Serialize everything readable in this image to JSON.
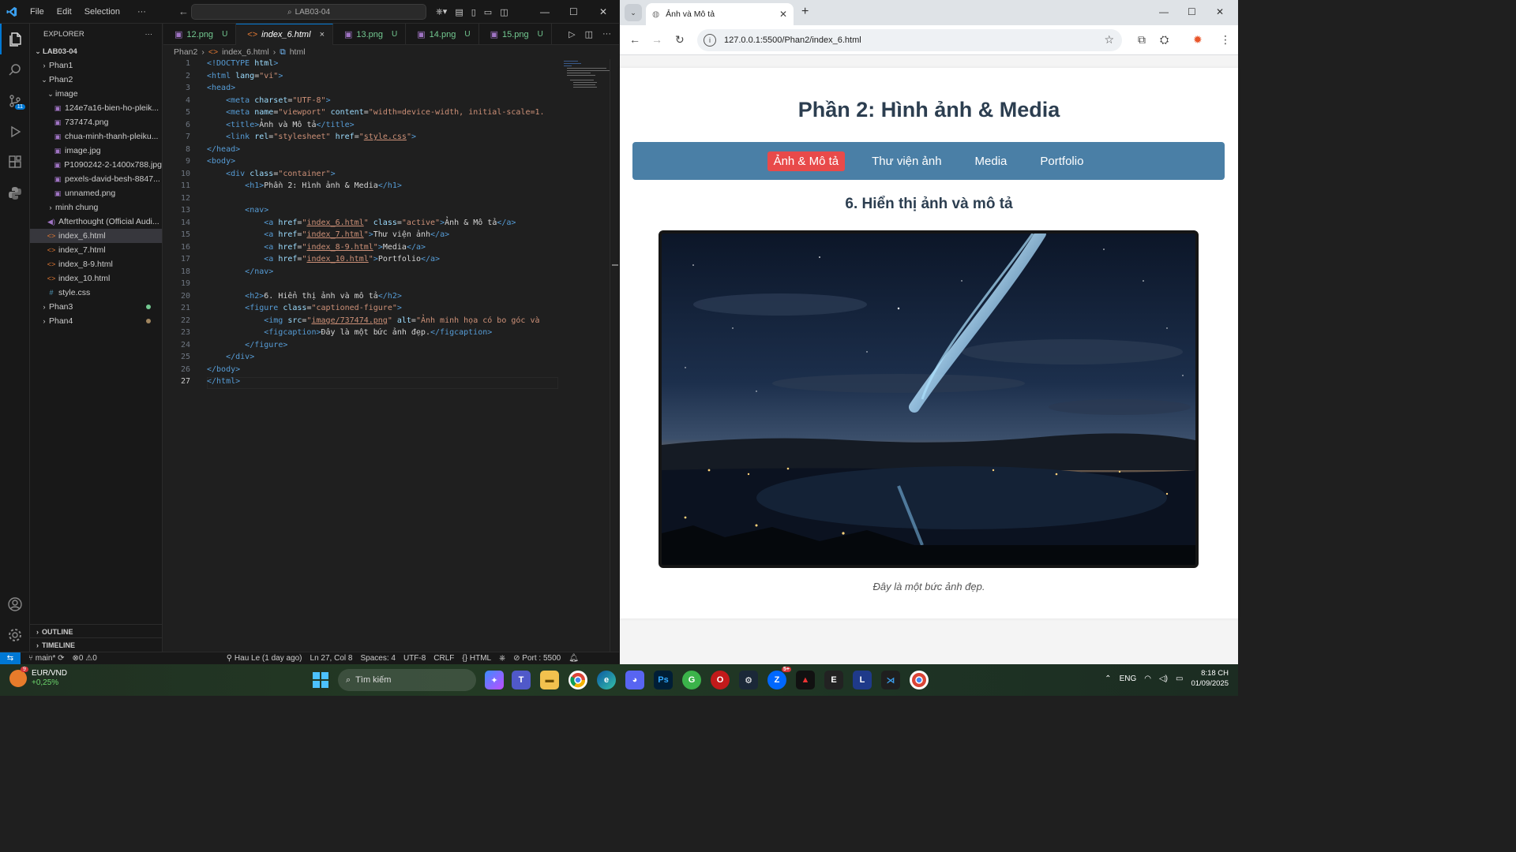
{
  "vscode": {
    "menu": [
      "File",
      "Edit",
      "Selection",
      "···"
    ],
    "search_text": "LAB03-04",
    "explorer_title": "EXPLORER",
    "explorer_more": "···",
    "root_folder": "LAB03-04",
    "tree": [
      {
        "label": "Phan1",
        "kind": "folder-closed",
        "depth": 1
      },
      {
        "label": "Phan2",
        "kind": "folder-open",
        "depth": 1
      },
      {
        "label": "image",
        "kind": "folder-open",
        "depth": 2
      },
      {
        "label": "124e7a16-bien-ho-pleik...",
        "kind": "image",
        "depth": 3
      },
      {
        "label": "737474.png",
        "kind": "image",
        "depth": 3
      },
      {
        "label": "chua-minh-thanh-pleiku...",
        "kind": "image",
        "depth": 3
      },
      {
        "label": "image.jpg",
        "kind": "image",
        "depth": 3
      },
      {
        "label": "P1090242-2-1400x788.jpg",
        "kind": "image",
        "depth": 3
      },
      {
        "label": "pexels-david-besh-8847...",
        "kind": "image",
        "depth": 3
      },
      {
        "label": "unnamed.png",
        "kind": "image",
        "depth": 3
      },
      {
        "label": "minh chung",
        "kind": "folder-closed",
        "depth": 2
      },
      {
        "label": "Afterthought (Official Audi...",
        "kind": "audio",
        "depth": 2
      },
      {
        "label": "index_6.html",
        "kind": "html",
        "depth": 2,
        "selected": true
      },
      {
        "label": "index_7.html",
        "kind": "html",
        "depth": 2
      },
      {
        "label": "index_8-9.html",
        "kind": "html",
        "depth": 2
      },
      {
        "label": "index_10.html",
        "kind": "html",
        "depth": 2
      },
      {
        "label": "style.css",
        "kind": "css",
        "depth": 2
      },
      {
        "label": "Phan3",
        "kind": "folder-closed",
        "depth": 1,
        "dot": "green"
      },
      {
        "label": "Phan4",
        "kind": "folder-closed",
        "depth": 1,
        "dot": "brown"
      }
    ],
    "outline_label": "OUTLINE",
    "timeline_label": "TIMELINE",
    "source_control_badge": "11",
    "tabs": [
      {
        "label": "12.png",
        "status": "U",
        "type": "image"
      },
      {
        "label": "index_6.html",
        "status": "×",
        "type": "html",
        "active": true
      },
      {
        "label": "13.png",
        "status": "U",
        "type": "image"
      },
      {
        "label": "14.png",
        "status": "U",
        "type": "image"
      },
      {
        "label": "15.png",
        "status": "U",
        "type": "image"
      }
    ],
    "breadcrumb": [
      "Phan2",
      "index_6.html",
      "html"
    ],
    "current_line": 27,
    "status": {
      "branch": "main*",
      "errors": "0",
      "warnings": "0",
      "blame": "Hau Le (1 day ago)",
      "position": "Ln 27, Col 8",
      "spaces": "Spaces: 4",
      "encoding": "UTF-8",
      "eol": "CRLF",
      "language": "HTML",
      "port": "Port : 5500"
    }
  },
  "browser": {
    "tab_title": "Ảnh và Mô tả",
    "url": "127.0.0.1:5500/Phan2/index_6.html",
    "page": {
      "h1": "Phần 2: Hình ảnh & Media",
      "nav": [
        {
          "label": "Ảnh & Mô tả",
          "active": true
        },
        {
          "label": "Thư viện ảnh",
          "active": false
        },
        {
          "label": "Media",
          "active": false
        },
        {
          "label": "Portfolio",
          "active": false
        }
      ],
      "h2": "6. Hiển thị ảnh và mô tả",
      "figcaption": "Đây là một bức ảnh đẹp."
    }
  },
  "taskbar": {
    "ticker_badge": "9",
    "ticker_name": "EUR/VND",
    "ticker_change": "+0,25%",
    "search_placeholder": "Tìm kiếm",
    "zalo_badge": "5+",
    "language": "ENG",
    "time": "8:18 CH",
    "date": "01/09/2025"
  }
}
